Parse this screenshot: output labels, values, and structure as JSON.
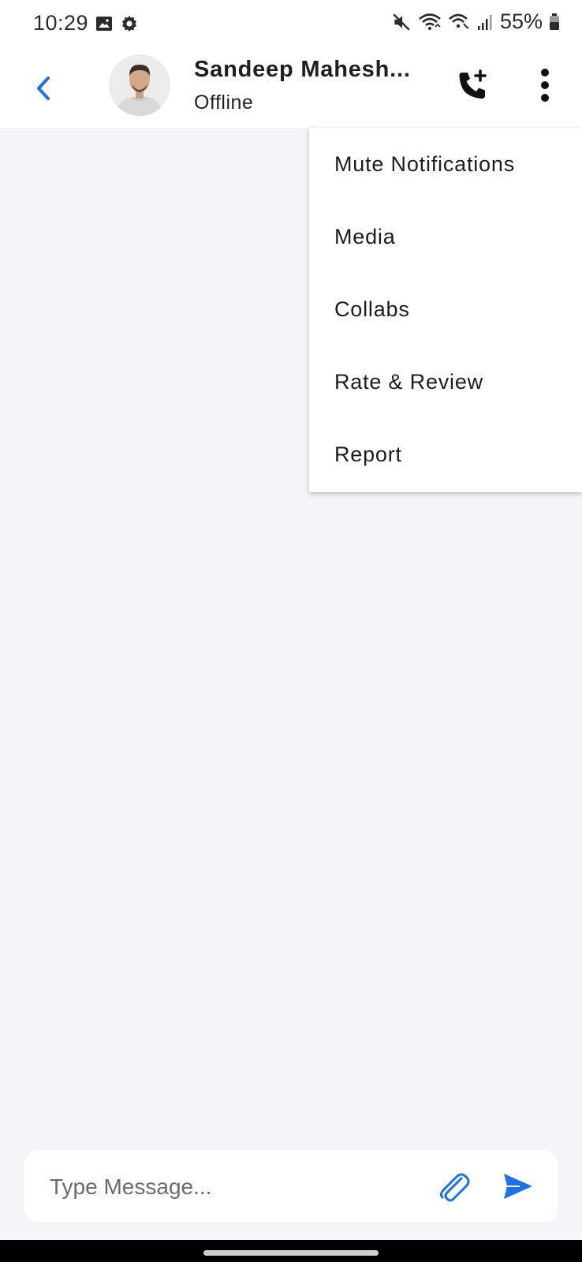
{
  "status_bar": {
    "time": "10:29",
    "battery": "55%",
    "icons": [
      "gallery-icon",
      "settings-gear-icon",
      "mute-icon",
      "wifi-icon",
      "wifi-call-icon",
      "signal-icon",
      "battery-icon"
    ]
  },
  "header": {
    "contact_name": "Sandeep Mahesh...",
    "contact_status": "Offline",
    "accent_color": "#1a73e8"
  },
  "menu": {
    "items": [
      {
        "label": "Mute Notifications"
      },
      {
        "label": "Media"
      },
      {
        "label": "Collabs"
      },
      {
        "label": "Rate & Review"
      },
      {
        "label": "Report"
      }
    ]
  },
  "composer": {
    "placeholder": "Type Message...",
    "value": ""
  },
  "colors": {
    "background": "#f3f5f9",
    "surface": "#ffffff",
    "accent": "#1a73e8"
  }
}
